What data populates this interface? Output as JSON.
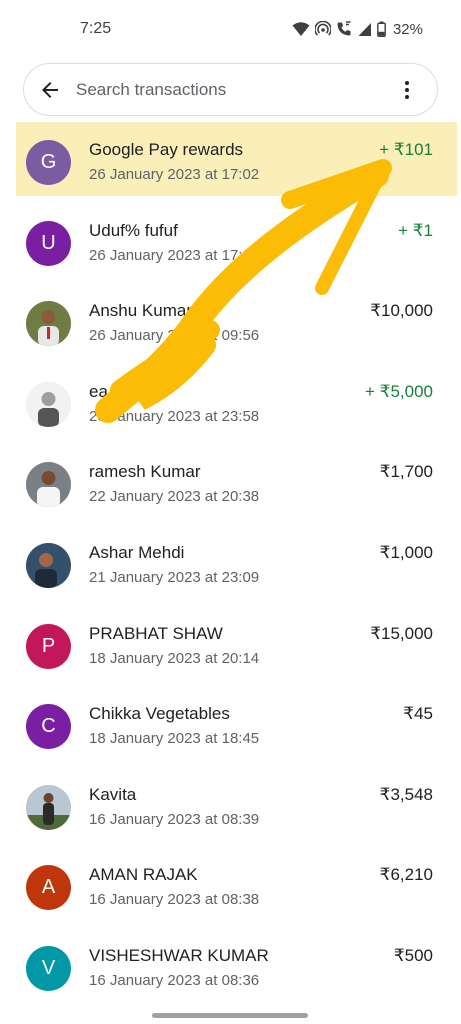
{
  "status_bar": {
    "time": "7:25",
    "battery": "32%",
    "icons": [
      "wifi-icon",
      "hotspot-icon",
      "wifi-calling-icon",
      "signal-icon",
      "battery-icon"
    ]
  },
  "search": {
    "placeholder": "Search transactions",
    "back_icon": "arrow-left-icon",
    "menu_icon": "more-vert-icon"
  },
  "colors": {
    "credit": "#188038",
    "highlight": "#fbefb9",
    "annotation": "#fbbc05"
  },
  "transactions": [
    {
      "name": "Google Pay rewards",
      "date": "26 January 2023 at 17:02",
      "amount": "+ ₹101",
      "credit": true,
      "initial": "G",
      "avatar_color": "#7b5ba1"
    },
    {
      "name": "Uduf% fufuf",
      "date": "26 January 2023 at 17:0",
      "amount": "+ ₹1",
      "credit": true,
      "initial": "U",
      "avatar_color": "#7b1fa2"
    },
    {
      "name": "Anshu Kumar",
      "date": "26 January 2023 at 09:56",
      "amount": "₹10,000",
      "credit": false,
      "initial": "",
      "avatar_color": "#5b6b3a"
    },
    {
      "name": "ea         ya com",
      "date": "23 January 2023 at 23:58",
      "amount": "+ ₹5,000",
      "credit": true,
      "initial": "",
      "avatar_color": "#c9c9c9"
    },
    {
      "name": "ramesh Kumar",
      "date": "22 January 2023 at 20:38",
      "amount": "₹1,700",
      "credit": false,
      "initial": "",
      "avatar_color": "#8a8f95"
    },
    {
      "name": "Ashar Mehdi",
      "date": "21 January 2023 at 23:09",
      "amount": "₹1,000",
      "credit": false,
      "initial": "",
      "avatar_color": "#3f5a78"
    },
    {
      "name": "PRABHAT  SHAW",
      "date": "18 January 2023 at 20:14",
      "amount": "₹15,000",
      "credit": false,
      "initial": "P",
      "avatar_color": "#c2185b"
    },
    {
      "name": "Chikka Vegetables",
      "date": "18 January 2023 at 18:45",
      "amount": "₹45",
      "credit": false,
      "initial": "C",
      "avatar_color": "#7b1fa2"
    },
    {
      "name": "Kavita",
      "date": "16 January 2023 at 08:39",
      "amount": "₹3,548",
      "credit": false,
      "initial": "",
      "avatar_color": "#6d7f8f"
    },
    {
      "name": "AMAN  RAJAK",
      "date": "16 January 2023 at 08:38",
      "amount": "₹6,210",
      "credit": false,
      "initial": "A",
      "avatar_color": "#bf360c"
    },
    {
      "name": "VISHESHWAR KUMAR",
      "date": "16 January 2023 at 08:36",
      "amount": "₹500",
      "credit": false,
      "initial": "V",
      "avatar_color": "#0097a7"
    }
  ]
}
